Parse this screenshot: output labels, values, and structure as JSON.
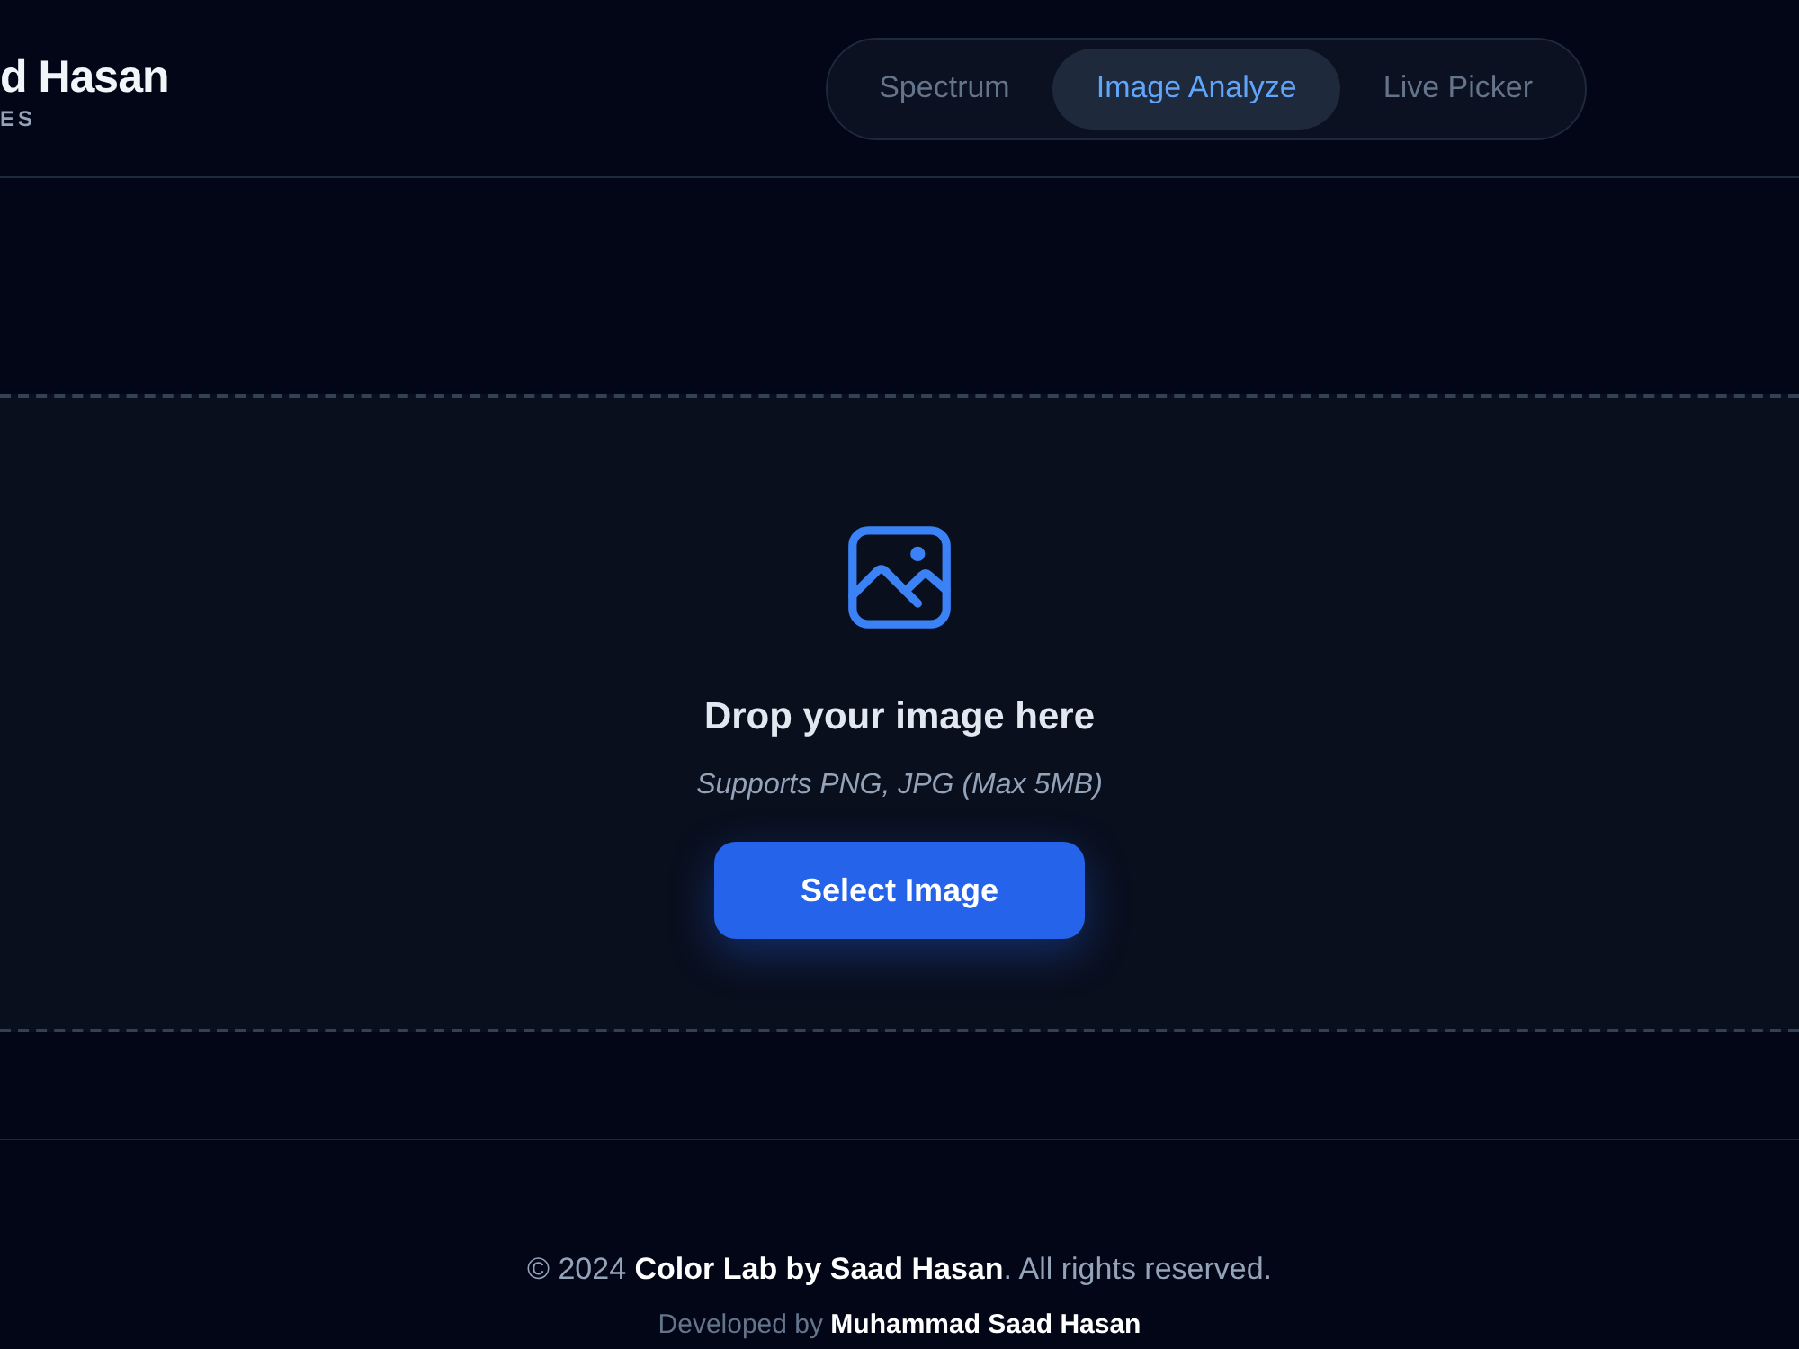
{
  "header": {
    "logo_title": "d Hasan",
    "logo_subtitle": "ES"
  },
  "tabs": [
    {
      "label": "Spectrum",
      "selected": false
    },
    {
      "label": "Image Analyze",
      "selected": true
    },
    {
      "label": "Live Picker",
      "selected": false
    }
  ],
  "dropzone": {
    "title": "Drop your image here",
    "hint": "Supports PNG, JPG (Max 5MB)",
    "button": "Select Image"
  },
  "footer": {
    "copyright": "© 2024 **Color Lab by Saad Hasan**. All rights reserved.",
    "credit": "Developed by **Muhammad Saad Hasan**"
  }
}
